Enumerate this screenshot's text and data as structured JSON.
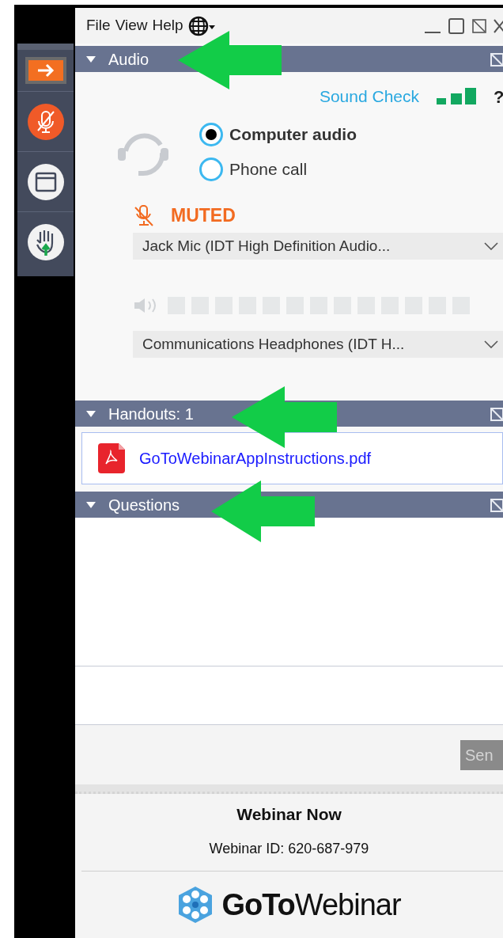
{
  "menu": [
    {
      "label": "File"
    },
    {
      "label": "View"
    },
    {
      "label": "Help"
    }
  ],
  "sidebar": [
    {
      "kind": "arrow",
      "selected": true
    },
    {
      "kind": "mic",
      "selected": false
    },
    {
      "kind": "window",
      "selected": false
    },
    {
      "kind": "hand",
      "selected": false
    }
  ],
  "audio": {
    "title": "Audio",
    "expanded": true,
    "sound_check": "Sound Check",
    "help": "?",
    "options": [
      {
        "label": "Computer audio",
        "selected": true
      },
      {
        "label": "Phone call",
        "selected": false
      }
    ],
    "status": "MUTED",
    "microphone": "Jack Mic (IDT High Definition Audio...",
    "speaker_meter": {
      "level": 0
    },
    "speaker": "Communications Headphones (IDT H..."
  },
  "handouts": {
    "title": "Handouts: 1",
    "expanded": true,
    "files": [
      {
        "name": "GoToWebinarAppInstructions.pdf"
      }
    ]
  },
  "questions": {
    "title": "Questions",
    "expanded": true,
    "send_button": "Sen"
  },
  "footer": {
    "title": "Webinar Now",
    "webinar_id": "Webinar ID: 620-687-979",
    "logo_bold": "GoTo",
    "logo_light": "Webinar"
  }
}
